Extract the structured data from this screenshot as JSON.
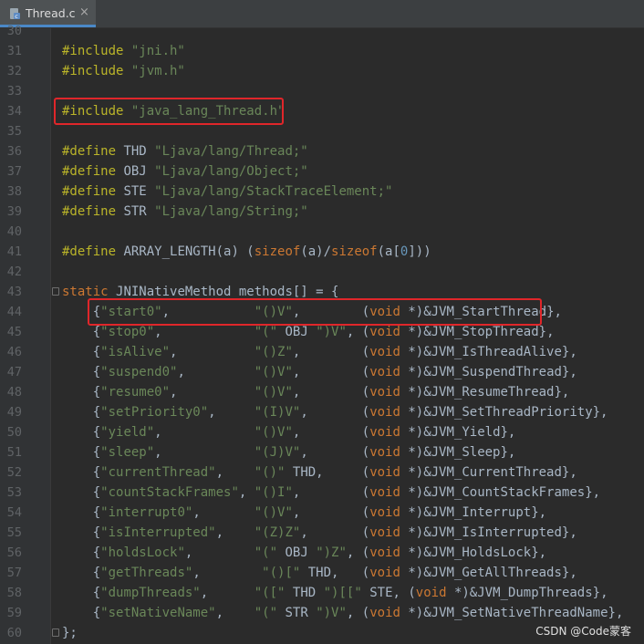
{
  "tab": {
    "label": "Thread.c",
    "close_glyph": "×",
    "icon": "c-file-icon"
  },
  "colors": {
    "background": "#2b2b2b",
    "keyword": "#cc7832",
    "preprocessor": "#bbb529",
    "string": "#6a8759",
    "number": "#6897bb",
    "highlight_box": "#e0262a"
  },
  "editor": {
    "lines": [
      {
        "n": "30",
        "t": []
      },
      {
        "n": "31",
        "t": [
          [
            "pp",
            "#include "
          ],
          [
            "str",
            "\"jni.h\""
          ]
        ]
      },
      {
        "n": "32",
        "t": [
          [
            "pp",
            "#include "
          ],
          [
            "str",
            "\"jvm.h\""
          ]
        ]
      },
      {
        "n": "33",
        "t": []
      },
      {
        "n": "34",
        "t": [
          [
            "pp",
            "#include "
          ],
          [
            "str",
            "\"java_lang_Thread.h\""
          ]
        ]
      },
      {
        "n": "35",
        "t": []
      },
      {
        "n": "36",
        "t": [
          [
            "pp",
            "#define "
          ],
          [
            "p",
            "THD "
          ],
          [
            "str",
            "\"Ljava/lang/Thread;\""
          ]
        ]
      },
      {
        "n": "37",
        "t": [
          [
            "pp",
            "#define "
          ],
          [
            "p",
            "OBJ "
          ],
          [
            "str",
            "\"Ljava/lang/Object;\""
          ]
        ]
      },
      {
        "n": "38",
        "t": [
          [
            "pp",
            "#define "
          ],
          [
            "p",
            "STE "
          ],
          [
            "str",
            "\"Ljava/lang/StackTraceElement;\""
          ]
        ]
      },
      {
        "n": "39",
        "t": [
          [
            "pp",
            "#define "
          ],
          [
            "p",
            "STR "
          ],
          [
            "str",
            "\"Ljava/lang/String;\""
          ]
        ]
      },
      {
        "n": "40",
        "t": []
      },
      {
        "n": "41",
        "t": [
          [
            "pp",
            "#define "
          ],
          [
            "p",
            "ARRAY_LENGTH(a) ("
          ],
          [
            "kw",
            "sizeof"
          ],
          [
            "p",
            "(a)/"
          ],
          [
            "kw",
            "sizeof"
          ],
          [
            "p",
            "(a["
          ],
          [
            "num",
            "0"
          ],
          [
            "p",
            "]))"
          ]
        ]
      },
      {
        "n": "42",
        "t": []
      },
      {
        "n": "43",
        "t": [
          [
            "kw",
            "static "
          ],
          [
            "p",
            "JNINativeMethod methods[] = {"
          ]
        ]
      },
      {
        "n": "44",
        "t": [
          [
            "p",
            "    {"
          ],
          [
            "str",
            "\"start0\""
          ],
          [
            "p",
            ",           "
          ],
          [
            "str",
            "\"()V\""
          ],
          [
            "p",
            ",        ("
          ],
          [
            "kw",
            "void"
          ],
          [
            "p",
            " *)&JVM_StartThread},"
          ]
        ]
      },
      {
        "n": "45",
        "t": [
          [
            "p",
            "    {"
          ],
          [
            "str",
            "\"stop0\""
          ],
          [
            "p",
            ",            "
          ],
          [
            "str",
            "\"(\""
          ],
          [
            "p",
            " OBJ "
          ],
          [
            "str",
            "\")V\""
          ],
          [
            "p",
            ", ("
          ],
          [
            "kw",
            "void"
          ],
          [
            "p",
            " *)&JVM_StopThread},"
          ]
        ]
      },
      {
        "n": "46",
        "t": [
          [
            "p",
            "    {"
          ],
          [
            "str",
            "\"isAlive\""
          ],
          [
            "p",
            ",          "
          ],
          [
            "str",
            "\"()Z\""
          ],
          [
            "p",
            ",        ("
          ],
          [
            "kw",
            "void"
          ],
          [
            "p",
            " *)&JVM_IsThreadAlive},"
          ]
        ]
      },
      {
        "n": "47",
        "t": [
          [
            "p",
            "    {"
          ],
          [
            "str",
            "\"suspend0\""
          ],
          [
            "p",
            ",         "
          ],
          [
            "str",
            "\"()V\""
          ],
          [
            "p",
            ",        ("
          ],
          [
            "kw",
            "void"
          ],
          [
            "p",
            " *)&JVM_SuspendThread},"
          ]
        ]
      },
      {
        "n": "48",
        "t": [
          [
            "p",
            "    {"
          ],
          [
            "str",
            "\"resume0\""
          ],
          [
            "p",
            ",          "
          ],
          [
            "str",
            "\"()V\""
          ],
          [
            "p",
            ",        ("
          ],
          [
            "kw",
            "void"
          ],
          [
            "p",
            " *)&JVM_ResumeThread},"
          ]
        ]
      },
      {
        "n": "49",
        "t": [
          [
            "p",
            "    {"
          ],
          [
            "str",
            "\"setPriority0\""
          ],
          [
            "p",
            ",     "
          ],
          [
            "str",
            "\"(I)V\""
          ],
          [
            "p",
            ",       ("
          ],
          [
            "kw",
            "void"
          ],
          [
            "p",
            " *)&JVM_SetThreadPriority},"
          ]
        ]
      },
      {
        "n": "50",
        "t": [
          [
            "p",
            "    {"
          ],
          [
            "str",
            "\"yield\""
          ],
          [
            "p",
            ",            "
          ],
          [
            "str",
            "\"()V\""
          ],
          [
            "p",
            ",        ("
          ],
          [
            "kw",
            "void"
          ],
          [
            "p",
            " *)&JVM_Yield},"
          ]
        ]
      },
      {
        "n": "51",
        "t": [
          [
            "p",
            "    {"
          ],
          [
            "str",
            "\"sleep\""
          ],
          [
            "p",
            ",            "
          ],
          [
            "str",
            "\"(J)V\""
          ],
          [
            "p",
            ",       ("
          ],
          [
            "kw",
            "void"
          ],
          [
            "p",
            " *)&JVM_Sleep},"
          ]
        ]
      },
      {
        "n": "52",
        "t": [
          [
            "p",
            "    {"
          ],
          [
            "str",
            "\"currentThread\""
          ],
          [
            "p",
            ",    "
          ],
          [
            "str",
            "\"()\""
          ],
          [
            "p",
            " THD,     ("
          ],
          [
            "kw",
            "void"
          ],
          [
            "p",
            " *)&JVM_CurrentThread},"
          ]
        ]
      },
      {
        "n": "53",
        "t": [
          [
            "p",
            "    {"
          ],
          [
            "str",
            "\"countStackFrames\""
          ],
          [
            "p",
            ", "
          ],
          [
            "str",
            "\"()I\""
          ],
          [
            "p",
            ",        ("
          ],
          [
            "kw",
            "void"
          ],
          [
            "p",
            " *)&JVM_CountStackFrames},"
          ]
        ]
      },
      {
        "n": "54",
        "t": [
          [
            "p",
            "    {"
          ],
          [
            "str",
            "\"interrupt0\""
          ],
          [
            "p",
            ",       "
          ],
          [
            "str",
            "\"()V\""
          ],
          [
            "p",
            ",        ("
          ],
          [
            "kw",
            "void"
          ],
          [
            "p",
            " *)&JVM_Interrupt},"
          ]
        ]
      },
      {
        "n": "55",
        "t": [
          [
            "p",
            "    {"
          ],
          [
            "str",
            "\"isInterrupted\""
          ],
          [
            "p",
            ",    "
          ],
          [
            "str",
            "\"(Z)Z\""
          ],
          [
            "p",
            ",       ("
          ],
          [
            "kw",
            "void"
          ],
          [
            "p",
            " *)&JVM_IsInterrupted},"
          ]
        ]
      },
      {
        "n": "56",
        "t": [
          [
            "p",
            "    {"
          ],
          [
            "str",
            "\"holdsLock\""
          ],
          [
            "p",
            ",        "
          ],
          [
            "str",
            "\"(\""
          ],
          [
            "p",
            " OBJ "
          ],
          [
            "str",
            "\")Z\""
          ],
          [
            "p",
            ", ("
          ],
          [
            "kw",
            "void"
          ],
          [
            "p",
            " *)&JVM_HoldsLock},"
          ]
        ]
      },
      {
        "n": "57",
        "t": [
          [
            "p",
            "    {"
          ],
          [
            "str",
            "\"getThreads\""
          ],
          [
            "p",
            ",        "
          ],
          [
            "str",
            "\"()[\""
          ],
          [
            "p",
            " THD,   ("
          ],
          [
            "kw",
            "void"
          ],
          [
            "p",
            " *)&JVM_GetAllThreads},"
          ]
        ]
      },
      {
        "n": "58",
        "t": [
          [
            "p",
            "    {"
          ],
          [
            "str",
            "\"dumpThreads\""
          ],
          [
            "p",
            ",      "
          ],
          [
            "str",
            "\"([\""
          ],
          [
            "p",
            " THD "
          ],
          [
            "str",
            "\")[[\""
          ],
          [
            "p",
            " STE, ("
          ],
          [
            "kw",
            "void"
          ],
          [
            "p",
            " *)&JVM_DumpThreads},"
          ]
        ]
      },
      {
        "n": "59",
        "t": [
          [
            "p",
            "    {"
          ],
          [
            "str",
            "\"setNativeName\""
          ],
          [
            "p",
            ",    "
          ],
          [
            "str",
            "\"(\""
          ],
          [
            "p",
            " STR "
          ],
          [
            "str",
            "\")V\""
          ],
          [
            "p",
            ", ("
          ],
          [
            "kw",
            "void"
          ],
          [
            "p",
            " *)&JVM_SetNativeThreadName},"
          ]
        ]
      },
      {
        "n": "60",
        "t": [
          [
            "p",
            "};"
          ]
        ]
      }
    ],
    "highlighted_lines": [
      "34",
      "44"
    ],
    "fold_markers": [
      "43",
      "60"
    ]
  },
  "watermark": "CSDN @Code蒙客"
}
